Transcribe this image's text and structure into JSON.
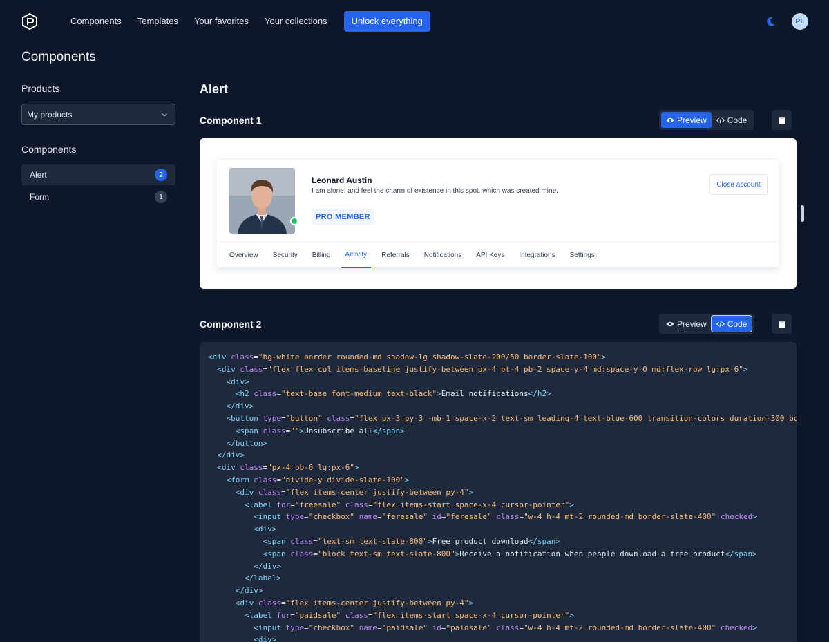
{
  "topbar": {
    "nav": [
      "Components",
      "Templates",
      "Your favorites",
      "Your collections"
    ],
    "unlock_label": "Unlock everything",
    "avatar_initials": "PL",
    "icons": [
      "logo-icon",
      "moon-icon"
    ]
  },
  "sidebar": {
    "page_title": "Components",
    "products_heading": "Products",
    "products_select": "My products",
    "components_heading": "Components",
    "items": [
      {
        "label": "Alert",
        "count": "2",
        "active": true
      },
      {
        "label": "Form",
        "count": "1",
        "active": false
      }
    ]
  },
  "main": {
    "section_title": "Alert",
    "preview_label": "Preview",
    "code_label": "Code",
    "component1": {
      "title": "Component 1",
      "view": "preview",
      "profile": {
        "name": "Leonard Austin",
        "description": "I am alone, and feel the charm of existence in this spot, which was created mine.",
        "badge": "PRO MEMBER",
        "close_button": "Close account",
        "tabs": [
          "Overview",
          "Security",
          "Billing",
          "Activity",
          "Referrals",
          "Notifications",
          "API Keys",
          "Integrations",
          "Settings"
        ],
        "active_tab": "Activity"
      }
    },
    "component2": {
      "title": "Component 2",
      "view": "code"
    }
  },
  "colors": {
    "background": "#0f172a",
    "panel": "#1e293b",
    "accent": "#2563eb",
    "online": "#22c55e"
  }
}
